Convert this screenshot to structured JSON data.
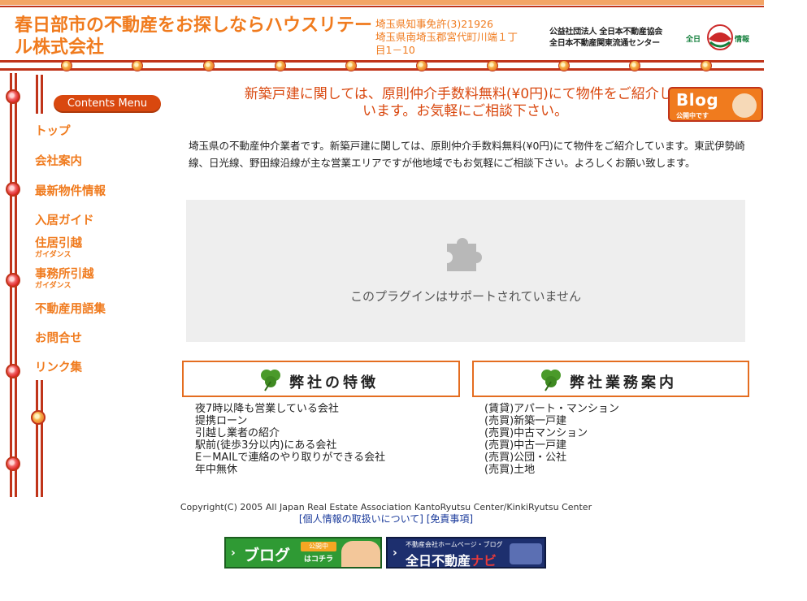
{
  "header": {
    "site_title": "春日部市の不動産をお探しならハウスリテール株式会社",
    "license_line1": "埼玉県知事免許(3)21926",
    "license_line2": "埼玉県南埼玉郡宮代町川端１丁目1－10",
    "assoc_line1": "公益社団法人 全日本不動産協会",
    "assoc_line2": "全日本不動産関東流通センター",
    "logo_label": "全日",
    "logo_label2": "情報"
  },
  "sidebar": {
    "menu_title": "Contents Menu",
    "items": [
      {
        "label": "トップ"
      },
      {
        "label": "会社案内"
      },
      {
        "label": "最新物件情報"
      },
      {
        "label": "入居ガイド"
      },
      {
        "label": "住居引越",
        "sub": "ガイダンス"
      },
      {
        "label": "事務所引越",
        "sub": "ガイダンス"
      },
      {
        "label": "不動産用語集"
      },
      {
        "label": "お問合せ"
      },
      {
        "label": "リンク集"
      }
    ]
  },
  "main": {
    "notice": "新築戸建に関しては、原則仲介手数料無料(¥0円)にて物件をご紹介しています。お気軽にご相談下さい。",
    "blog_badge": {
      "title": "Blog",
      "sub": "公開中です"
    },
    "intro": "埼玉県の不動産仲介業者です。新築戸建に関しては、原則仲介手数料無料(¥0円)にて物件をご紹介しています。東武伊勢崎線、日光線、野田線沿線が主な営業エリアですが他地域でもお気軽にご相談下さい。よろしくお願い致します。",
    "plugin_message": "このプラグインはサポートされていません",
    "features": {
      "title": "弊社の特徴",
      "items": [
        "夜7時以降も営業している会社",
        "提携ローン",
        "引越し業者の紹介",
        "駅前(徒歩3分以内)にある会社",
        "E－MAILで連絡のやり取りができる会社",
        "年中無休"
      ]
    },
    "services": {
      "title": "弊社業務案内",
      "items": [
        "(賃貸)アパート・マンション",
        "(売買)新築一戸建",
        "(売買)中古マンション",
        "(売買)中古一戸建",
        "(売買)公団・公社",
        "(売買)土地"
      ]
    }
  },
  "footer": {
    "copyright": "Copyright(C) 2005 All Japan Real Estate Association KantoRyutsu Center/KinkiRyutsu Center",
    "link_privacy": "[個人情報の取扱いについて]",
    "link_disclaimer": "[免責事項]",
    "banner_blog": {
      "title": "ブログ",
      "badge": "公開中",
      "sub": "はコチラ"
    },
    "banner_navi": {
      "top": "不動産会社ホームページ・ブログ",
      "main": "全日不動産",
      "accent": "ナビ"
    }
  },
  "colors": {
    "accent_orange": "#f07b1e",
    "rail_red": "#c0341a",
    "link_blue": "#1a3a9b"
  }
}
